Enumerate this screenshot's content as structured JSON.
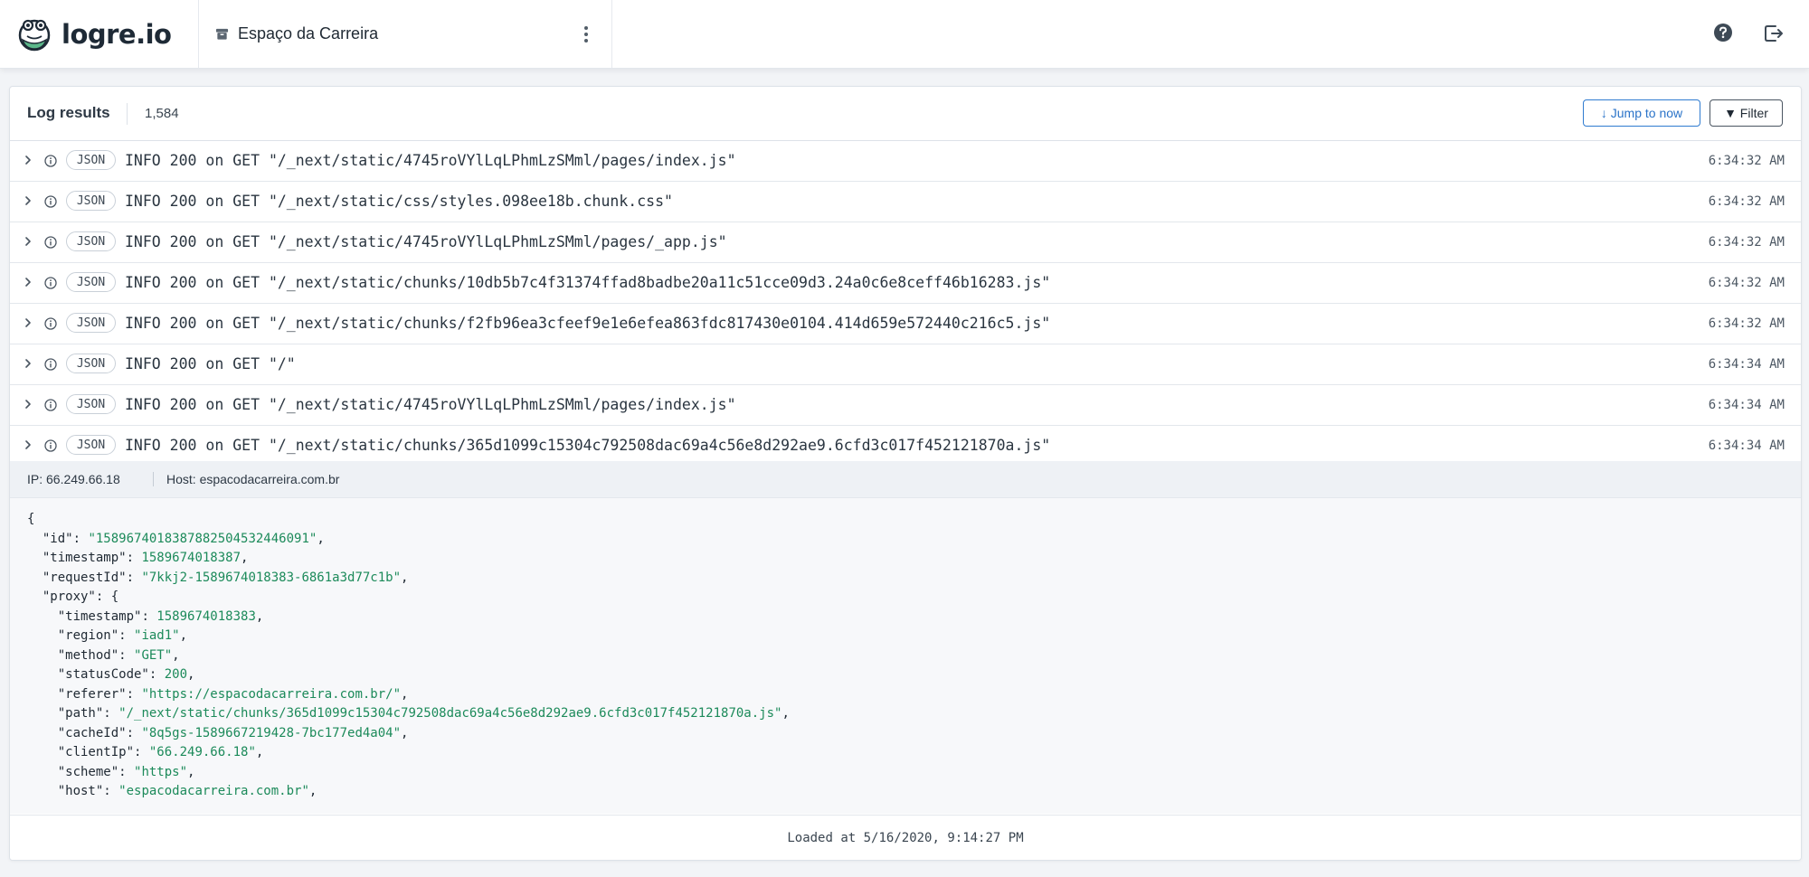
{
  "app": {
    "name": "logre.io"
  },
  "project": {
    "name": "Espaço da Carreira"
  },
  "icons": {
    "logo": "frog-logo-icon",
    "project": "archive-box-icon",
    "menu": "kebab-menu-icon",
    "help": "help-circle-icon",
    "logout": "logout-icon",
    "expand": "chevron-right-icon",
    "level": "info-circle-icon"
  },
  "colors": {
    "accent": "#2a73c8",
    "json_value": "#1c8a5a",
    "logo_green": "#5cb88a"
  },
  "log_panel": {
    "title": "Log results",
    "count": "1,584",
    "jump_label": "↓ Jump to now",
    "filter_label": "▼ Filter"
  },
  "logs": [
    {
      "badge": "JSON",
      "message": "INFO 200 on GET \"/_next/static/4745roVYlLqLPhmLzSMml/pages/index.js\"",
      "time": "6:34:32 AM"
    },
    {
      "badge": "JSON",
      "message": "INFO 200 on GET \"/_next/static/css/styles.098ee18b.chunk.css\"",
      "time": "6:34:32 AM"
    },
    {
      "badge": "JSON",
      "message": "INFO 200 on GET \"/_next/static/4745roVYlLqLPhmLzSMml/pages/_app.js\"",
      "time": "6:34:32 AM"
    },
    {
      "badge": "JSON",
      "message": "INFO 200 on GET \"/_next/static/chunks/10db5b7c4f31374ffad8badbe20a11c51cce09d3.24a0c6e8ceff46b16283.js\"",
      "time": "6:34:32 AM"
    },
    {
      "badge": "JSON",
      "message": "INFO 200 on GET \"/_next/static/chunks/f2fb96ea3cfeef9e1e6efea863fdc817430e0104.414d659e572440c216c5.js\"",
      "time": "6:34:32 AM"
    },
    {
      "badge": "JSON",
      "message": "INFO 200 on GET \"/\"",
      "time": "6:34:34 AM"
    },
    {
      "badge": "JSON",
      "message": "INFO 200 on GET \"/_next/static/4745roVYlLqLPhmLzSMml/pages/index.js\"",
      "time": "6:34:34 AM"
    },
    {
      "badge": "JSON",
      "message": "INFO 200 on GET \"/_next/static/chunks/365d1099c15304c792508dac69a4c56e8d292ae9.6cfd3c017f452121870a.js\"",
      "time": "6:34:34 AM"
    }
  ],
  "detail": {
    "ip": "IP: 66.249.66.18",
    "host": "Host: espacodacarreira.com.br",
    "json_lines": [
      [
        {
          "t": "p",
          "v": "{"
        }
      ],
      [
        {
          "t": "p",
          "v": "  "
        },
        {
          "t": "k",
          "v": "\"id\""
        },
        {
          "t": "p",
          "v": ": "
        },
        {
          "t": "s",
          "v": "\"158967401838788250453244609​1\""
        },
        {
          "t": "p",
          "v": ","
        }
      ],
      [
        {
          "t": "p",
          "v": "  "
        },
        {
          "t": "k",
          "v": "\"timestamp\""
        },
        {
          "t": "p",
          "v": ": "
        },
        {
          "t": "n",
          "v": "1589674018387"
        },
        {
          "t": "p",
          "v": ","
        }
      ],
      [
        {
          "t": "p",
          "v": "  "
        },
        {
          "t": "k",
          "v": "\"requestId\""
        },
        {
          "t": "p",
          "v": ": "
        },
        {
          "t": "s",
          "v": "\"7kkj2-1589674018383-6861a3d77c1b\""
        },
        {
          "t": "p",
          "v": ","
        }
      ],
      [
        {
          "t": "p",
          "v": "  "
        },
        {
          "t": "k",
          "v": "\"proxy\""
        },
        {
          "t": "p",
          "v": ": {"
        }
      ],
      [
        {
          "t": "p",
          "v": "    "
        },
        {
          "t": "k",
          "v": "\"timestamp\""
        },
        {
          "t": "p",
          "v": ": "
        },
        {
          "t": "n",
          "v": "1589674018383"
        },
        {
          "t": "p",
          "v": ","
        }
      ],
      [
        {
          "t": "p",
          "v": "    "
        },
        {
          "t": "k",
          "v": "\"region\""
        },
        {
          "t": "p",
          "v": ": "
        },
        {
          "t": "s",
          "v": "\"iad1\""
        },
        {
          "t": "p",
          "v": ","
        }
      ],
      [
        {
          "t": "p",
          "v": "    "
        },
        {
          "t": "k",
          "v": "\"method\""
        },
        {
          "t": "p",
          "v": ": "
        },
        {
          "t": "s",
          "v": "\"GET\""
        },
        {
          "t": "p",
          "v": ","
        }
      ],
      [
        {
          "t": "p",
          "v": "    "
        },
        {
          "t": "k",
          "v": "\"statusCode\""
        },
        {
          "t": "p",
          "v": ": "
        },
        {
          "t": "n",
          "v": "200"
        },
        {
          "t": "p",
          "v": ","
        }
      ],
      [
        {
          "t": "p",
          "v": "    "
        },
        {
          "t": "k",
          "v": "\"referer\""
        },
        {
          "t": "p",
          "v": ": "
        },
        {
          "t": "s",
          "v": "\"https://espacodacarreira.com.br/\""
        },
        {
          "t": "p",
          "v": ","
        }
      ],
      [
        {
          "t": "p",
          "v": "    "
        },
        {
          "t": "k",
          "v": "\"path\""
        },
        {
          "t": "p",
          "v": ": "
        },
        {
          "t": "s",
          "v": "\"/_next/static/chunks/365d1099c15304c792508dac69a4c56e8d292ae9.6cfd3c017f452121870a.js\""
        },
        {
          "t": "p",
          "v": ","
        }
      ],
      [
        {
          "t": "p",
          "v": "    "
        },
        {
          "t": "k",
          "v": "\"cacheId\""
        },
        {
          "t": "p",
          "v": ": "
        },
        {
          "t": "s",
          "v": "\"8q5gs-1589667219428-7bc177ed4a04\""
        },
        {
          "t": "p",
          "v": ","
        }
      ],
      [
        {
          "t": "p",
          "v": "    "
        },
        {
          "t": "k",
          "v": "\"clientIp\""
        },
        {
          "t": "p",
          "v": ": "
        },
        {
          "t": "s",
          "v": "\"66.249.66.18\""
        },
        {
          "t": "p",
          "v": ","
        }
      ],
      [
        {
          "t": "p",
          "v": "    "
        },
        {
          "t": "k",
          "v": "\"scheme\""
        },
        {
          "t": "p",
          "v": ": "
        },
        {
          "t": "s",
          "v": "\"https\""
        },
        {
          "t": "p",
          "v": ","
        }
      ],
      [
        {
          "t": "p",
          "v": "    "
        },
        {
          "t": "k",
          "v": "\"host\""
        },
        {
          "t": "p",
          "v": ": "
        },
        {
          "t": "s",
          "v": "\"espacodacarreira.com.br\""
        },
        {
          "t": "p",
          "v": ","
        }
      ]
    ]
  },
  "footer": {
    "loaded_at": "Loaded at 5/16/2020, 9:14:27 PM"
  }
}
